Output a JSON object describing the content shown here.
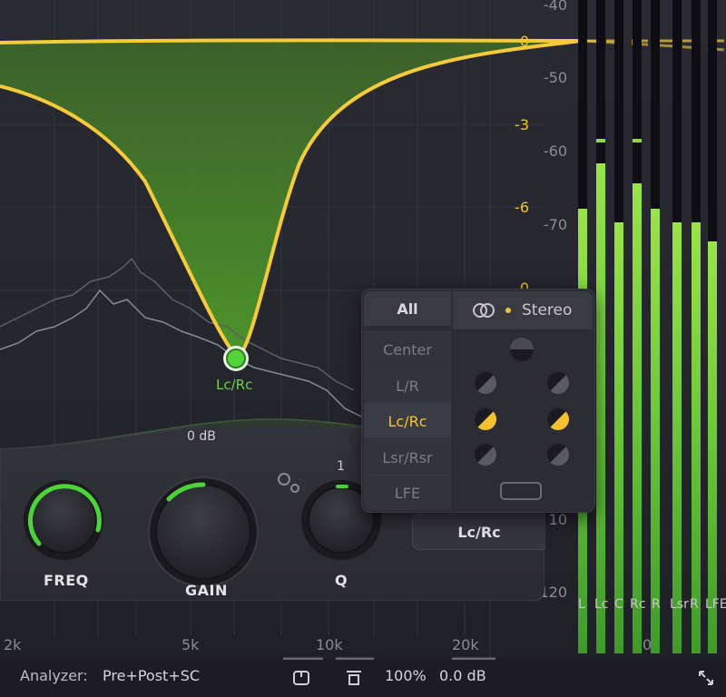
{
  "db_scale_right": [
    "-40",
    "-50",
    "-60",
    "-70",
    "10",
    "-120"
  ],
  "db_scale_yellow": [
    "0",
    "-3",
    "-6",
    "0"
  ],
  "freq_labels": [
    "2k",
    "5k",
    "10k",
    "20k",
    "0"
  ],
  "band_label": "Lc/Rc",
  "knobs": {
    "freq_label": "FREQ",
    "gain_label": "GAIN",
    "gain_value": "0 dB",
    "q_label": "Q",
    "q_value": "1"
  },
  "channel_popup": {
    "header": "All",
    "stereo_label": "Stereo",
    "items": [
      "Center",
      "L/R",
      "Lc/Rc",
      "Lsr/Rsr",
      "LFE"
    ],
    "selected": "Lc/Rc"
  },
  "channel_button_label": "Lc/Rc",
  "meters": {
    "labels": [
      "L",
      "Lc",
      "C",
      "Rc",
      "R",
      "Lsr",
      "R",
      "LFE"
    ],
    "levels": [
      0.68,
      0.75,
      0.66,
      0.72,
      0.68,
      0.66,
      0.66,
      0.63
    ],
    "accent_color": "#7ad23e"
  },
  "status_bar": {
    "analyzer_label": "Analyzer:",
    "analyzer_value": "Pre+Post+SC",
    "zoom": "100%",
    "gain": "0.0 dB"
  },
  "colors": {
    "curve": "#f5cb3c",
    "fill_green": "#4f9a2a",
    "node_green": "#54d43a",
    "selected_yellow": "#f2c230"
  }
}
